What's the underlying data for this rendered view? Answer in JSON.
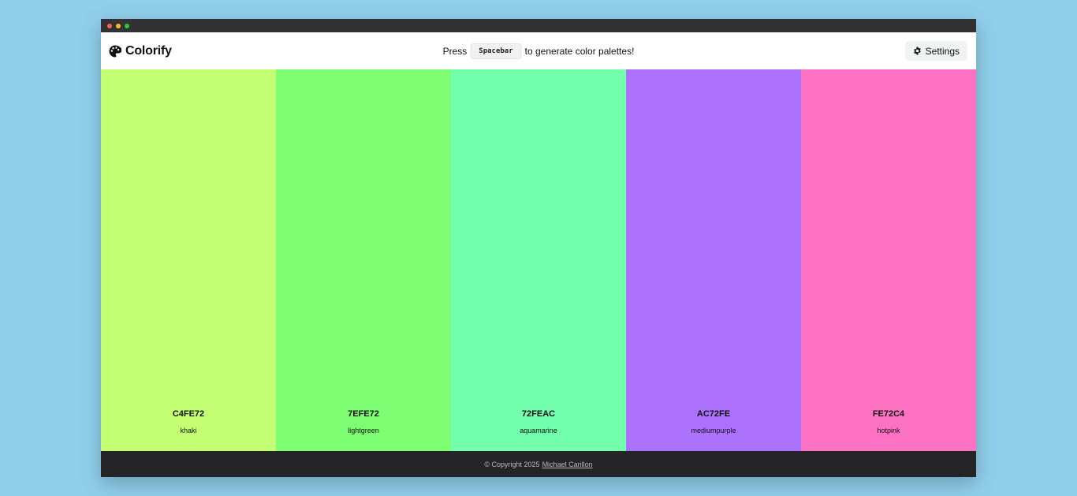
{
  "app": {
    "name": "Colorify"
  },
  "header": {
    "hint_before": "Press",
    "hint_key": "Spacebar",
    "hint_after": "to generate color palettes!",
    "settings_label": "Settings"
  },
  "palette": {
    "swatches": [
      {
        "hex": "C4FE72",
        "name": "khaki",
        "color": "#C4FE72"
      },
      {
        "hex": "7EFE72",
        "name": "lightgreen",
        "color": "#7EFE72"
      },
      {
        "hex": "72FEAC",
        "name": "aquamarine",
        "color": "#72FEAC"
      },
      {
        "hex": "AC72FE",
        "name": "mediumpurple",
        "color": "#AC72FE"
      },
      {
        "hex": "FE72C4",
        "name": "hotpink",
        "color": "#FE72C4"
      }
    ]
  },
  "footer": {
    "copyright": "© Copyright 2025",
    "author": "Michael Carillon"
  },
  "icons": {
    "brand": "palette-icon",
    "settings": "gear-icon"
  }
}
